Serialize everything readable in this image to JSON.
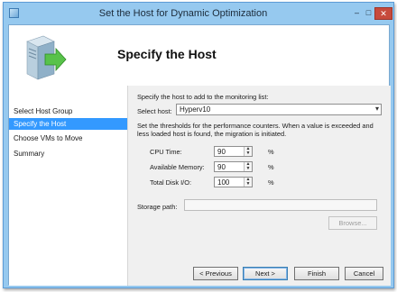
{
  "window": {
    "title": "Set the Host for Dynamic Optimization",
    "controls": [
      "–",
      "□",
      "✕"
    ]
  },
  "banner": {
    "heading": "Specify the Host"
  },
  "sidebar": {
    "items": [
      {
        "label": "Select Host Group",
        "active": false
      },
      {
        "label": "Specify the Host",
        "active": true
      },
      {
        "label": "Choose VMs to Move",
        "active": false
      },
      {
        "label": "Summary",
        "active": false
      }
    ]
  },
  "form": {
    "instruction": "Specify the host to add to the monitoring list:",
    "select_host_label": "Select host:",
    "select_host_value": "Hyperv10",
    "thresholds_text_line1": "Set the thresholds for the performance counters. When a value is exceeded and",
    "thresholds_text_line2": "less loaded host is found, the migration is initiated.",
    "cpu_label": "CPU Time:",
    "cpu_value": "90",
    "memory_label": "Available Memory:",
    "memory_value": "90",
    "disk_label": "Total Disk I/O:",
    "disk_value": "100",
    "unit": "%",
    "storage_label": "Storage path:",
    "storage_value": "",
    "browse_label": "Browse..."
  },
  "footer": {
    "previous_label": "< Previous",
    "next_label": "Next >",
    "finish_label": "Finish",
    "cancel_label": "Cancel"
  },
  "colors": {
    "accent": "#3399ff",
    "title_bar": "#96c9ef",
    "close_button": "#c74a3c"
  }
}
